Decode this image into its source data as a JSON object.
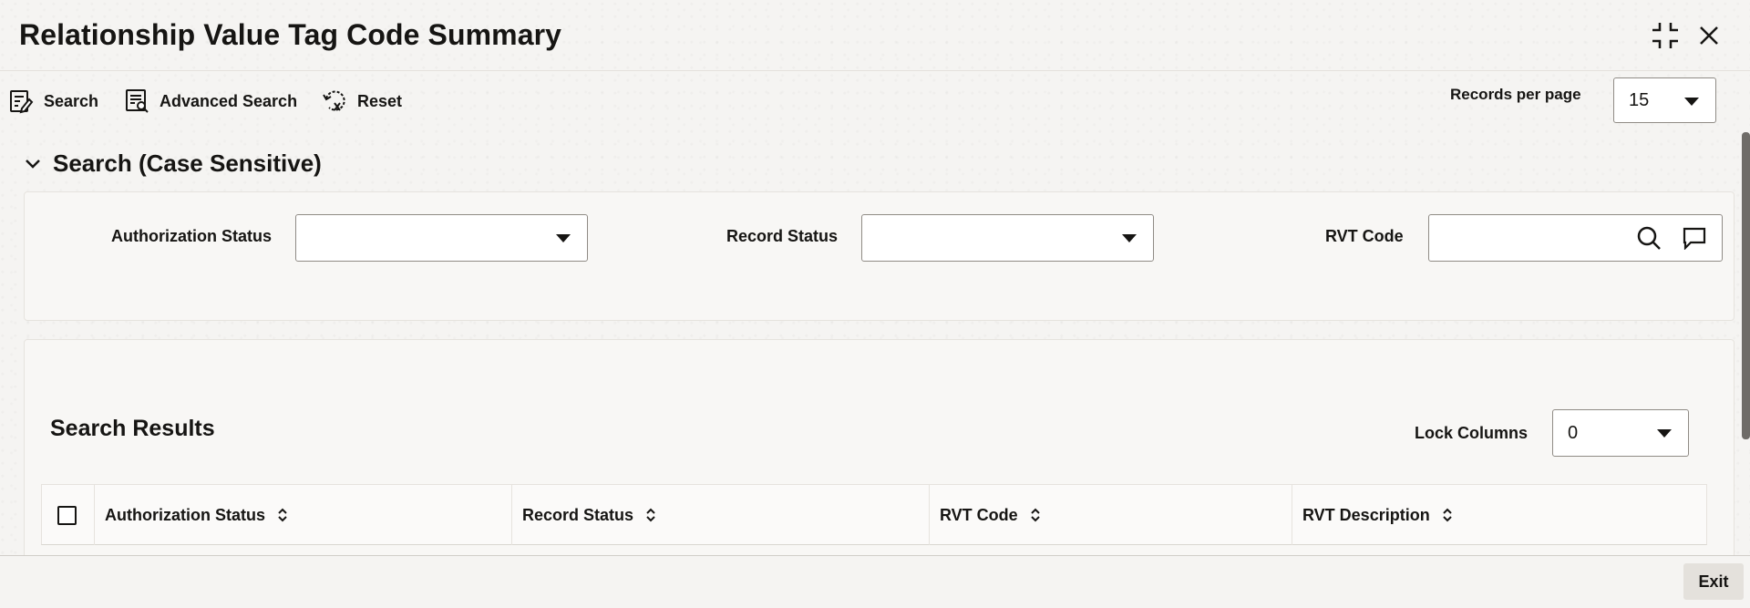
{
  "page": {
    "title": "Relationship Value Tag Code Summary"
  },
  "toolbar": {
    "search_label": "Search",
    "advanced_search_label": "Advanced Search",
    "reset_label": "Reset"
  },
  "records_per_page": {
    "label": "Records per page",
    "value": "15"
  },
  "search_section": {
    "title": "Search (Case Sensitive)",
    "authorization_status_label": "Authorization Status",
    "authorization_status_value": "",
    "record_status_label": "Record Status",
    "record_status_value": "",
    "rvt_code_label": "RVT Code",
    "rvt_code_value": ""
  },
  "results": {
    "title": "Search Results",
    "lock_columns_label": "Lock Columns",
    "lock_columns_value": "0",
    "columns": [
      "Authorization Status",
      "Record Status",
      "RVT Code",
      "RVT Description"
    ]
  },
  "footer": {
    "exit_label": "Exit"
  },
  "icons": {
    "expand": "expand-icon",
    "close": "close-icon",
    "search": "search-doc-icon",
    "advanced_search": "advanced-search-icon",
    "reset": "reset-icon",
    "collapse": "chevron-down-icon",
    "lookup": "search-icon",
    "comment": "comment-icon",
    "sort": "sort-icon"
  },
  "colors": {
    "text": "#161513",
    "background": "#f5f4f2",
    "panel": "#f8f7f5",
    "scrollbar": "#6f6c68"
  }
}
